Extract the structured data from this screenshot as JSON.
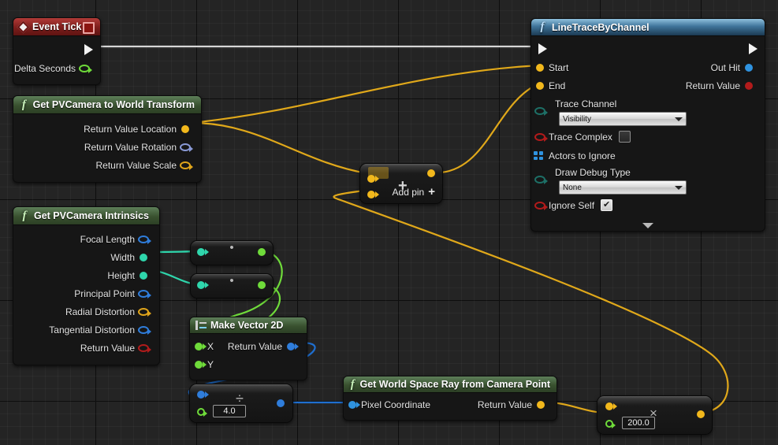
{
  "graph": {
    "background": "#242424",
    "grid_minor": "#2d2d2d",
    "grid_major": "#0a0a0a"
  },
  "nodes": {
    "event_tick": {
      "title": "Event Tick",
      "icon": "event-diamond-icon",
      "outputs": [
        {
          "label": "",
          "pin": "exec-out",
          "type": "exec"
        },
        {
          "label": "Delta Seconds",
          "pin": "delta-seconds",
          "type": "float",
          "color": "#6fdb3a"
        }
      ]
    },
    "camera_transform": {
      "title": "Get PVCamera to World Transform",
      "icon": "function-icon",
      "outputs": [
        {
          "label": "Return Value Location",
          "type": "vector",
          "color": "#f2b81c",
          "filled": true
        },
        {
          "label": "Return Value Rotation",
          "type": "rotator",
          "color": "#8a9ad6",
          "filled": false
        },
        {
          "label": "Return Value Scale",
          "type": "vector",
          "color": "#f2b81c",
          "filled": false
        }
      ]
    },
    "camera_intrinsics": {
      "title": "Get PVCamera Intrinsics",
      "icon": "function-icon",
      "outputs": [
        {
          "label": "Focal Length",
          "type": "vector2d",
          "color": "#2f7ddb",
          "filled": false
        },
        {
          "label": "Width",
          "type": "int",
          "color": "#2fd6ac",
          "filled": true
        },
        {
          "label": "Height",
          "type": "int",
          "color": "#2fd6ac",
          "filled": true
        },
        {
          "label": "Principal Point",
          "type": "vector2d",
          "color": "#2f7ddb",
          "filled": false
        },
        {
          "label": "Radial Distortion",
          "type": "struct",
          "color": "#e0a51b",
          "filled": false
        },
        {
          "label": "Tangential Distortion",
          "type": "vector2d",
          "color": "#2f7ddb",
          "filled": false
        },
        {
          "label": "Return Value",
          "type": "bool",
          "color": "#b21b1b",
          "filled": false
        }
      ]
    },
    "line_trace": {
      "title": "LineTraceByChannel",
      "icon": "function-icon",
      "inputs": [
        {
          "label": "Start",
          "type": "vector",
          "color": "#f2b81c",
          "filled": true
        },
        {
          "label": "End",
          "type": "vector",
          "color": "#f2b81c",
          "filled": true
        }
      ],
      "outputs": [
        {
          "label": "Out Hit",
          "type": "struct",
          "color": "#2f93e0",
          "filled": true
        },
        {
          "label": "Return Value",
          "type": "bool",
          "color": "#b21b1b",
          "filled": true
        }
      ],
      "params": [
        {
          "label": "Trace Channel",
          "widget": "dropdown",
          "value": "Visibility",
          "pin_color": "#1d6f66"
        },
        {
          "label": "Trace Complex",
          "widget": "checkbox",
          "value": "",
          "checked": false,
          "pin_color": "#b21b1b"
        },
        {
          "label": "Actors to Ignore",
          "widget": "array",
          "value": "",
          "pin_color": "#2f93e0"
        },
        {
          "label": "Draw Debug Type",
          "widget": "dropdown",
          "value": "None",
          "pin_color": "#1d6f66"
        },
        {
          "label": "Ignore Self",
          "widget": "checkbox",
          "value": "✔",
          "checked": true,
          "pin_color": "#b21b1b"
        }
      ],
      "collapse_icon": "chevron-down-icon"
    },
    "add_node": {
      "operator": "+",
      "add_pin_label": "Add pin",
      "add_pin_icon": "plus-icon",
      "pin_color": "#f2b81c"
    },
    "conv_width": {
      "operator": "•",
      "in_color": "#2fd6ac",
      "out_color": "#6fdb3a"
    },
    "conv_height": {
      "operator": "•",
      "in_color": "#2fd6ac",
      "out_color": "#6fdb3a"
    },
    "make_vector_2d": {
      "title": "Make Vector 2D",
      "icon": "make-struct-icon",
      "inputs": [
        {
          "label": "X",
          "type": "float",
          "color": "#6fdb3a"
        },
        {
          "label": "Y",
          "type": "float",
          "color": "#6fdb3a"
        }
      ],
      "outputs": [
        {
          "label": "Return Value",
          "type": "vector2d",
          "color": "#2f7ddb"
        }
      ]
    },
    "divide_node": {
      "operator": "÷",
      "value": "4.0",
      "in_color": "#2f7ddb",
      "literal_pin_color": "#6fdb3a",
      "out_color": "#2f7ddb"
    },
    "world_ray": {
      "title": "Get World Space Ray from Camera Point",
      "icon": "function-icon",
      "inputs": [
        {
          "label": "Pixel Coordinate",
          "type": "vector2d",
          "color": "#2f93e0"
        }
      ],
      "outputs": [
        {
          "label": "Return Value",
          "type": "vector",
          "color": "#f2b81c"
        }
      ]
    },
    "multiply_node": {
      "operator": "×",
      "value": "200.0",
      "in_color": "#f2b81c",
      "literal_pin_color": "#6fdb3a",
      "out_color": "#f2b81c"
    }
  },
  "wire_colors": {
    "exec": "#d6d6d6",
    "vector": "#e0a81a",
    "float": "#6fdb3a",
    "int": "#2fd6ac",
    "vector2d": "#1f6fd0"
  }
}
